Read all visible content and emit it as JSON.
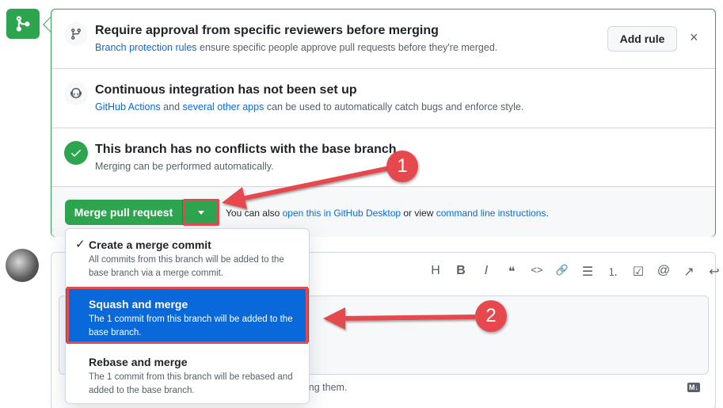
{
  "checks": {
    "reviewers": {
      "title": "Require approval from specific reviewers before merging",
      "link": "Branch protection rules",
      "text": " ensure specific people approve pull requests before they're merged.",
      "button": "Add rule",
      "close": "×"
    },
    "ci": {
      "title": "Continuous integration has not been set up",
      "link1": "GitHub Actions",
      "text1": " and ",
      "link2": "several other apps",
      "text2": " can be used to automatically catch bugs and enforce style."
    },
    "conflicts": {
      "title": "This branch has no conflicts with the base branch",
      "subtitle": "Merging can be performed automatically."
    }
  },
  "merge": {
    "button": "Merge pull request",
    "also_prefix": "You can also ",
    "desktop_link": "open this in GitHub Desktop",
    "or_view": " or view ",
    "cli_link": "command line instructions",
    "suffix": "."
  },
  "dropdown": {
    "options": [
      {
        "title": "Create a merge commit",
        "desc": "All commits from this branch will be added to the base branch via a merge commit.",
        "checked": true
      },
      {
        "title": "Squash and merge",
        "desc": "The 1 commit from this branch will be added to the base branch.",
        "selected": true
      },
      {
        "title": "Rebase and merge",
        "desc": "The 1 commit from this branch will be rebased and added to the base branch."
      }
    ]
  },
  "comment": {
    "toolbar": [
      "H",
      "B",
      "I",
      "❝",
      "<>",
      "🔗",
      "☰",
      "⒈",
      "☑",
      "@",
      "↗",
      "↩"
    ],
    "attach_hint": "ing them.",
    "md_badge": "M↓"
  },
  "annotations": [
    "1",
    "2"
  ],
  "colors": {
    "green": "#2da44e",
    "blue": "#0969da",
    "annotation_red": "#e5484d"
  }
}
